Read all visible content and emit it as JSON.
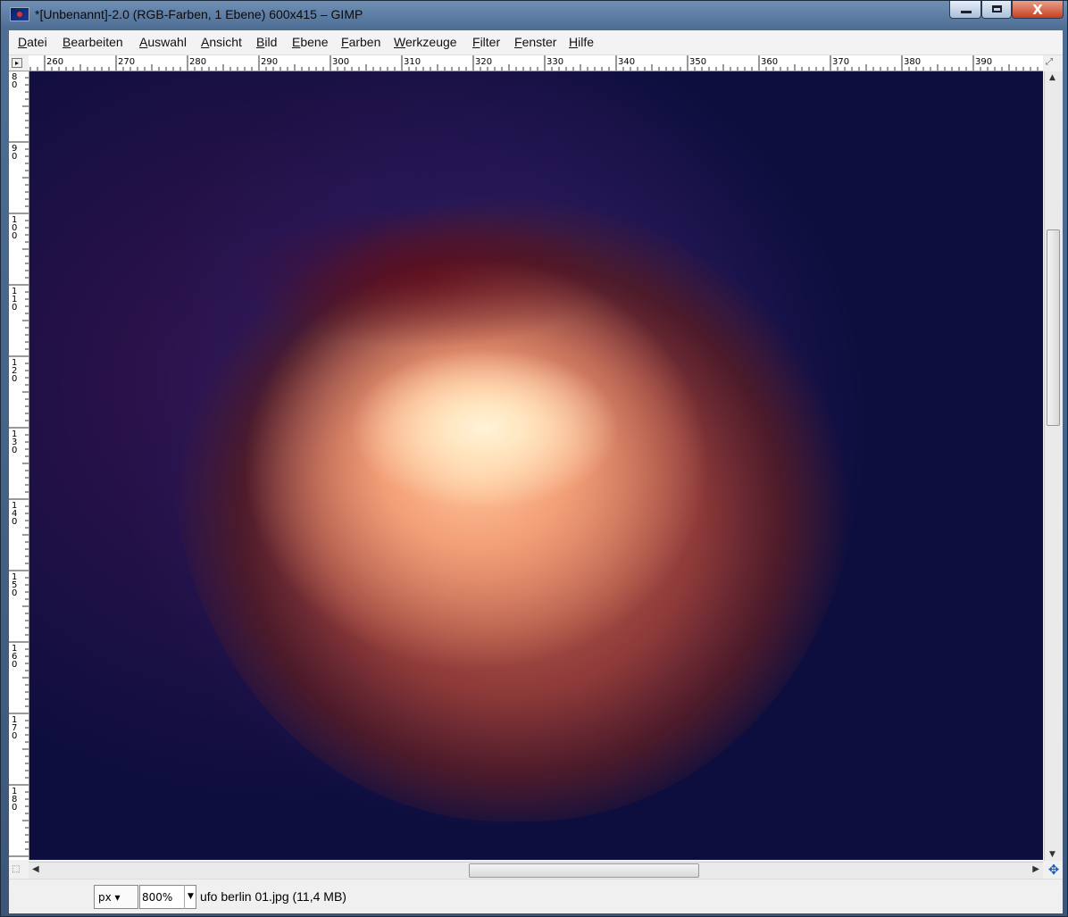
{
  "window": {
    "title": "*[Unbenannt]-2.0 (RGB-Farben, 1 Ebene) 600x415 – GIMP",
    "close_glyph": "X"
  },
  "menu": [
    {
      "label": "Datei"
    },
    {
      "label": "Bearbeiten"
    },
    {
      "label": "Auswahl"
    },
    {
      "label": "Ansicht"
    },
    {
      "label": "Bild"
    },
    {
      "label": "Ebene"
    },
    {
      "label": "Farben"
    },
    {
      "label": "Werkzeuge"
    },
    {
      "label": "Filter"
    },
    {
      "label": "Fenster"
    },
    {
      "label": "Hilfe"
    }
  ],
  "rulers": {
    "horizontal_labels": [
      "260",
      "270",
      "280",
      "290",
      "300",
      "310",
      "320",
      "330",
      "340",
      "350",
      "360",
      "370",
      "380",
      "390"
    ],
    "vertical_labels": [
      "80",
      "90",
      "100",
      "110",
      "120",
      "130",
      "140",
      "150",
      "160",
      "170",
      "180"
    ]
  },
  "scroll": {
    "vertical_fraction": 0.26,
    "horizontal_fraction": 0.44
  },
  "status": {
    "unit": "px",
    "zoom": "800",
    "zoom_unit": "%",
    "info": "ufo berlin 01.jpg (11,4 MB)"
  },
  "icons": {
    "app": "gimp-icon",
    "navigate": "navigate-icon",
    "quickmask": "quick-mask-icon",
    "zoom_toggle": "zoom-fit-icon"
  }
}
